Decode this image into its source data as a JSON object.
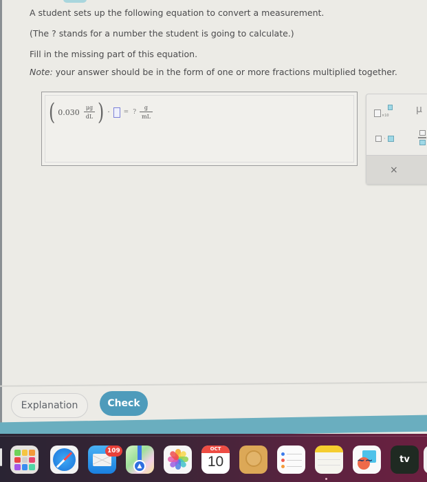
{
  "question": {
    "line1": "A student sets up the following equation to convert a measurement.",
    "line2": "(The ? stands for a number the student is going to calculate.)",
    "line3": "Fill in the missing part of this equation.",
    "note_label": "Note:",
    "note_text": " your answer should be in the form of one or more fractions multiplied together."
  },
  "equation": {
    "given_value": "0.030",
    "given_unit_numerator": "μg",
    "given_unit_denominator": "dL",
    "operator_multiply": "·",
    "operator_equals": "=",
    "unknown": "?",
    "result_unit_numerator": "g",
    "result_unit_denominator": "mL",
    "answer_slot_value": ""
  },
  "tool_panel": {
    "sci_notation_label": "×10",
    "mu_symbol": "μ",
    "multiply_dot": "·",
    "clear_symbol": "×"
  },
  "buttons": {
    "explanation": "Explanation",
    "check": "Check"
  },
  "dock": {
    "mail_badge": "109",
    "calendar_month": "OCT",
    "calendar_day": "10",
    "tv_label": "tv",
    "apps": [
      "Launchpad",
      "Safari",
      "Mail",
      "Maps",
      "Photos",
      "Calendar",
      "Contacts",
      "Reminders",
      "Notes",
      "Freeform",
      "Apple TV"
    ]
  },
  "colors": {
    "check_button": "#4e9bbb",
    "answer_slot_border": "#7a7fd8",
    "badge": "#e8403a",
    "tool_highlight": "#9fd8e6"
  }
}
